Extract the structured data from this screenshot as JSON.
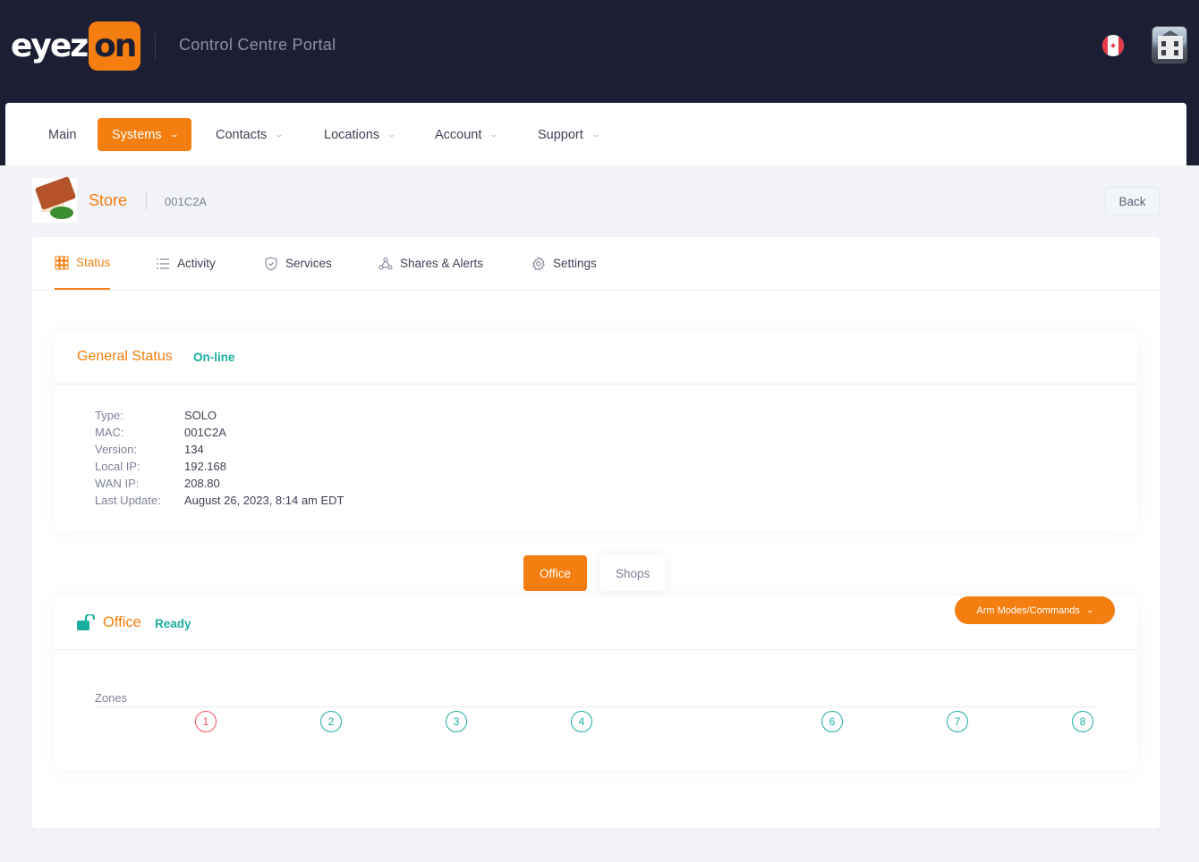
{
  "header": {
    "logo_text_left": "eyez",
    "logo_text_right": "on",
    "portal_title": "Control Centre Portal",
    "flag_icon": "canada-flag-icon",
    "avatar_icon": "house-photo-avatar"
  },
  "nav": {
    "items": [
      {
        "label": "Main",
        "has_dropdown": false
      },
      {
        "label": "Systems",
        "has_dropdown": true,
        "active": true
      },
      {
        "label": "Contacts",
        "has_dropdown": true
      },
      {
        "label": "Locations",
        "has_dropdown": true
      },
      {
        "label": "Account",
        "has_dropdown": true
      },
      {
        "label": "Support",
        "has_dropdown": true
      }
    ]
  },
  "page": {
    "store_name": "Store",
    "store_id": "001C2A",
    "back_label": "Back"
  },
  "tabs": [
    {
      "label": "Status",
      "icon": "grid-icon",
      "active": true
    },
    {
      "label": "Activity",
      "icon": "list-icon"
    },
    {
      "label": "Services",
      "icon": "shield-icon"
    },
    {
      "label": "Shares & Alerts",
      "icon": "share-network-icon"
    },
    {
      "label": "Settings",
      "icon": "gear-icon"
    }
  ],
  "general_status": {
    "title": "General Status",
    "status": "On-line",
    "fields": [
      {
        "key": "Type:",
        "value": "SOLO"
      },
      {
        "key": "MAC:",
        "value": "001C2A"
      },
      {
        "key": "Version:",
        "value": "134"
      },
      {
        "key": "Local IP:",
        "value": "192.168"
      },
      {
        "key": "WAN IP:",
        "value": "208.80"
      },
      {
        "key": "Last Update:",
        "value": "August 26, 2023, 8:14 am EDT"
      }
    ]
  },
  "partitions": {
    "active": "Office",
    "inactive": "Shops"
  },
  "office": {
    "title": "Office",
    "status": "Ready",
    "arm_button": "Arm Modes/Commands",
    "zones_label": "Zones",
    "zones": [
      {
        "num": "1",
        "state": "alarm"
      },
      {
        "num": "2",
        "state": "ok"
      },
      {
        "num": "3",
        "state": "ok"
      },
      {
        "num": "4",
        "state": "ok"
      },
      {
        "num": "6",
        "state": "ok"
      },
      {
        "num": "7",
        "state": "ok"
      },
      {
        "num": "8",
        "state": "ok"
      }
    ]
  },
  "colors": {
    "accent": "#f47e0f",
    "header_bg": "#1c1e33",
    "success": "#1bae9f",
    "danger": "#f64e60"
  }
}
